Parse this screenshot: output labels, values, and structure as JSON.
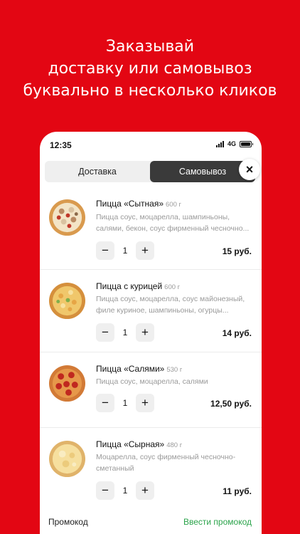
{
  "headline": {
    "line1": "Заказывай",
    "line2": "доставку или самовывоз",
    "line3": "буквально в несколько кликов"
  },
  "status": {
    "time": "12:35",
    "network": "4G"
  },
  "tabs": [
    {
      "label": "Доставка",
      "active": false
    },
    {
      "label": "Самовывоз",
      "active": true
    }
  ],
  "close_icon": "×",
  "items": [
    {
      "name": "Пицца «Сытная»",
      "weight": "600 г",
      "desc1": "Пицца соус, моцарелла, шампиньоны,",
      "desc2": "салями, бекон, соус фирменный чесночно...",
      "qty": "1",
      "price": "15 руб.",
      "minus": "−",
      "plus": "+"
    },
    {
      "name": "Пицца с курицей",
      "weight": "600 г",
      "desc1": "Пицца соус, моцарелла, соус майонезный,",
      "desc2": "филе куриное, шампиньоны, огурцы...",
      "qty": "1",
      "price": "14 руб.",
      "minus": "−",
      "plus": "+"
    },
    {
      "name": "Пицца «Салями»",
      "weight": "530 г",
      "desc1": "Пицца соус, моцарелла, салями",
      "desc2": "",
      "qty": "1",
      "price": "12,50 руб.",
      "minus": "−",
      "plus": "+"
    },
    {
      "name": "Пицца «Сырная»",
      "weight": "480 г",
      "desc1": "Моцарелла, соус фирменный чесночно-",
      "desc2": "сметанный",
      "qty": "1",
      "price": "11 руб.",
      "minus": "−",
      "plus": "+"
    }
  ],
  "promo": {
    "label": "Промокод",
    "link": "Ввести промокод"
  },
  "colors": {
    "brand": "#e30613",
    "accent_green": "#2aa34a",
    "active_tab": "#3a3a3a"
  }
}
